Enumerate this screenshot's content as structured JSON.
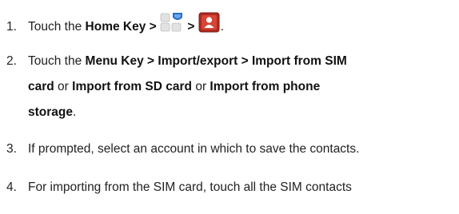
{
  "steps": [
    {
      "number": "1.",
      "text_before": "Touch the ",
      "bold_1": "Home Key >",
      "sep": " > ",
      "end": ".",
      "icons": [
        "apps-launcher-icon",
        "contacts-app-icon"
      ],
      "colors": {
        "apps_tile": "#e0e0e0",
        "apps_accent": "#2a6fc9",
        "contacts_red": "#c0392b"
      }
    },
    {
      "number": "2.",
      "t1": "Touch the ",
      "b1": "Menu Key > Import/export > Import from SIM",
      "b2": "card",
      "t2": " or ",
      "b3": "Import from SD card",
      "t3": " or ",
      "b4": "Import from phone",
      "b5": "storage",
      "end": "."
    },
    {
      "number": "3.",
      "text": "If prompted, select an account in which to save the contacts."
    },
    {
      "number": "4.",
      "text": "For importing from the SIM card, touch all the SIM contacts"
    }
  ]
}
